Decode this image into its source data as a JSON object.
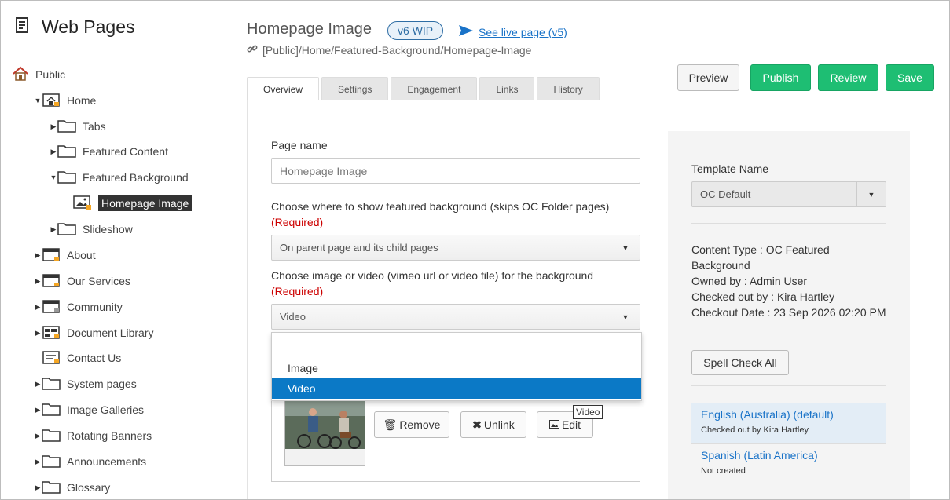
{
  "sidebar": {
    "title": "Web Pages",
    "items": [
      {
        "label": "Public"
      },
      {
        "label": "Home"
      },
      {
        "label": "Tabs"
      },
      {
        "label": "Featured Content"
      },
      {
        "label": "Featured Background"
      },
      {
        "label": "Homepage Image"
      },
      {
        "label": "Slideshow"
      },
      {
        "label": "About"
      },
      {
        "label": "Our Services"
      },
      {
        "label": "Community"
      },
      {
        "label": "Document Library"
      },
      {
        "label": "Contact Us"
      },
      {
        "label": "System pages"
      },
      {
        "label": "Image Galleries"
      },
      {
        "label": "Rotating Banners"
      },
      {
        "label": "Announcements"
      },
      {
        "label": "Glossary"
      }
    ]
  },
  "header": {
    "title": "Homepage Image",
    "badge": "v6 WIP",
    "live_link": "See live page (v5)",
    "path": "[Public]/Home/Featured-Background/Homepage-Image"
  },
  "toolbar": {
    "preview": "Preview",
    "publish": "Publish",
    "review": "Review",
    "save": "Save"
  },
  "tabs": [
    "Overview",
    "Settings",
    "Engagement",
    "Links",
    "History"
  ],
  "form": {
    "page_name_label": "Page name",
    "page_name_value": "Homepage Image",
    "show_bg_label": "Choose where to show featured background (skips OC Folder pages)",
    "required": "(Required)",
    "show_bg_value": "On parent page and its child pages",
    "media_label": "Choose image or video (vimeo url or video file) for the background",
    "media_value": "Video",
    "dropdown_options": [
      "",
      "Image",
      "Video"
    ],
    "remove": "Remove",
    "unlink": "Unlink",
    "edit": "Edit",
    "tooltip": "Video"
  },
  "right": {
    "template_label": "Template Name",
    "template_value": "OC Default",
    "content_type_a": "Content Type : OC Featured",
    "content_type_b": "Background",
    "owned_by": "Owned by : Admin User",
    "checked_out_by": "Checked out by : Kira Hartley",
    "checkout_date": "Checkout Date : 23 Sep 2026 02:20 PM",
    "spell_check": "Spell Check All",
    "languages": [
      {
        "name": "English (Australia) (default)",
        "status": "Checked out by Kira Hartley"
      },
      {
        "name": "Spanish (Latin America)",
        "status": "Not created"
      }
    ]
  },
  "colors": {
    "accent_green": "#1ebe73",
    "link_blue": "#1a73c8",
    "selected_blue": "#0b79c6",
    "required_red": "#cc0000"
  }
}
